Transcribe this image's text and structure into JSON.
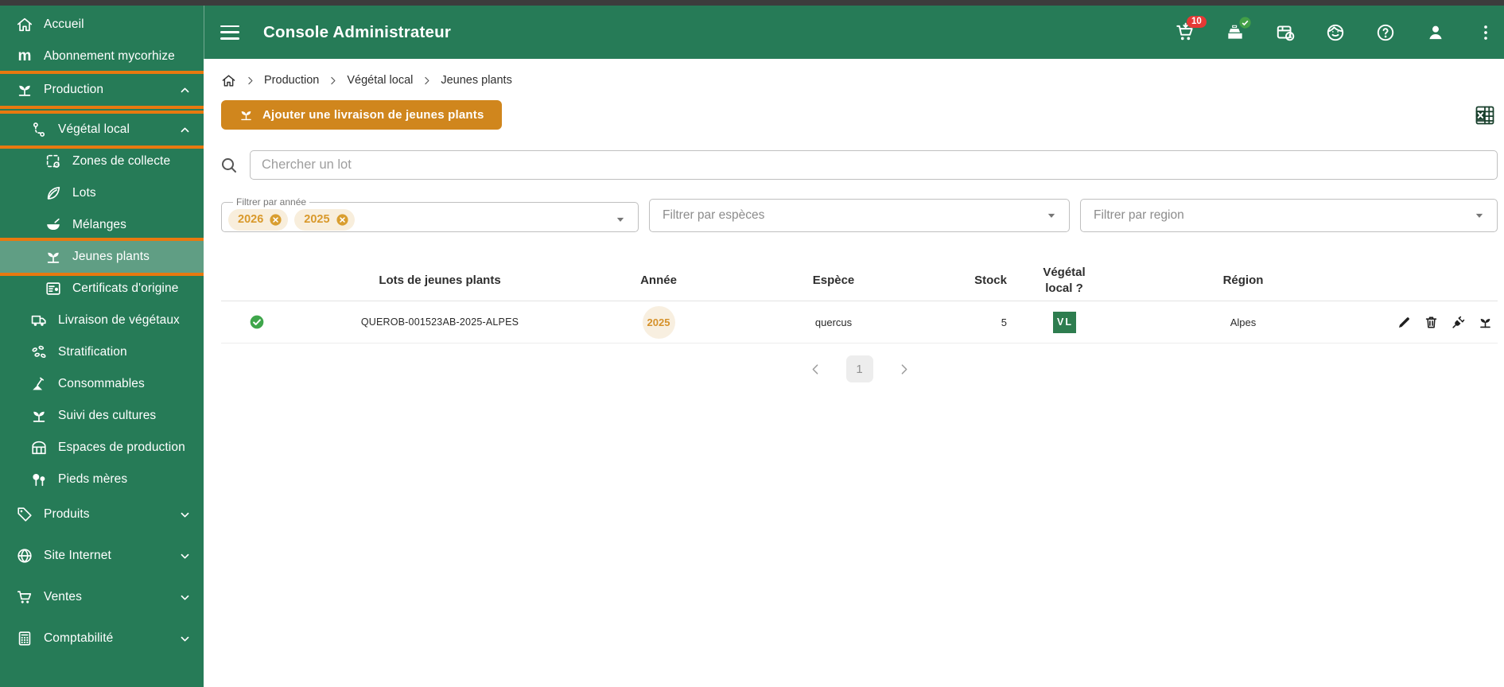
{
  "topbar": {
    "title": "Console Administrateur",
    "cart_badge": "10"
  },
  "sidebar": {
    "logo_glyph": "m",
    "items": [
      {
        "label": "Accueil"
      },
      {
        "label": "Abonnement mycorhize"
      },
      {
        "label": "Production"
      },
      {
        "label": "Végétal local"
      },
      {
        "label": "Zones de collecte"
      },
      {
        "label": "Lots"
      },
      {
        "label": "Mélanges"
      },
      {
        "label": "Jeunes plants"
      },
      {
        "label": "Certificats d'origine"
      },
      {
        "label": "Livraison de végétaux"
      },
      {
        "label": "Stratification"
      },
      {
        "label": "Consommables"
      },
      {
        "label": "Suivi des cultures"
      },
      {
        "label": "Espaces de production"
      },
      {
        "label": "Pieds mères"
      },
      {
        "label": "Produits"
      },
      {
        "label": "Site Internet"
      },
      {
        "label": "Ventes"
      },
      {
        "label": "Comptabilité"
      }
    ]
  },
  "breadcrumb": {
    "items": [
      "Production",
      "Végétal local",
      "Jeunes plants"
    ]
  },
  "toolbar": {
    "add_button_label": "Ajouter une livraison de jeunes plants"
  },
  "search": {
    "placeholder": "Chercher un lot"
  },
  "filters": {
    "year": {
      "label": "Filtrer par année",
      "chips": [
        {
          "label": "2026"
        },
        {
          "label": "2025"
        }
      ]
    },
    "species": {
      "placeholder": "Filtrer par espèces"
    },
    "region": {
      "placeholder": "Filtrer par region"
    }
  },
  "table": {
    "headers": {
      "lot": "Lots de jeunes plants",
      "year": "Année",
      "species": "Espèce",
      "stock": "Stock",
      "vl": "Végétal local ?",
      "region": "Région"
    },
    "rows": [
      {
        "lot": "QUEROB-001523AB-2025-ALPES",
        "year": "2025",
        "species": "quercus",
        "stock": "5",
        "vl": "VL",
        "region": "Alpes"
      }
    ]
  },
  "pagination": {
    "page": "1"
  },
  "colors": {
    "brand_green": "#267B57",
    "annotation_orange": "#E8790F",
    "button_orange": "#D0861D",
    "chip_text_orange": "#D9992B",
    "chip_bg": "#F8EEDC",
    "badge_red": "#E53935",
    "vl_badge_green": "#2E7D4F",
    "check_green": "#3FA64B",
    "top_strip": "#3C3C3C"
  }
}
